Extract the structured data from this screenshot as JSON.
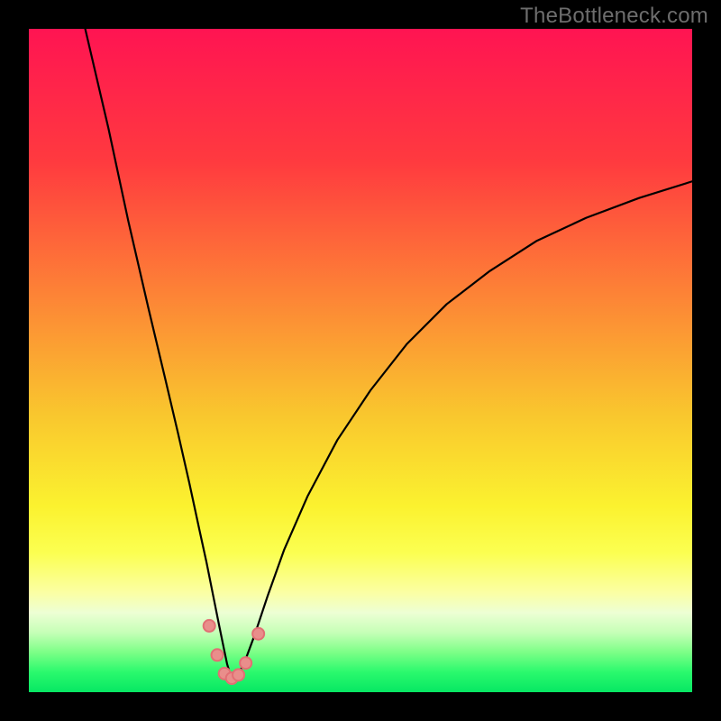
{
  "watermark": "TheBottleneck.com",
  "chart_data": {
    "type": "line",
    "title": "",
    "xlabel": "",
    "ylabel": "",
    "xlim": [
      0,
      100
    ],
    "ylim": [
      0,
      100
    ],
    "grid": false,
    "legend": false,
    "gradient_stops": [
      {
        "offset": 0,
        "color": "#ff1452"
      },
      {
        "offset": 20,
        "color": "#ff3a3f"
      },
      {
        "offset": 40,
        "color": "#fd8336"
      },
      {
        "offset": 58,
        "color": "#f9c62e"
      },
      {
        "offset": 72,
        "color": "#fbf22f"
      },
      {
        "offset": 79,
        "color": "#fbff51"
      },
      {
        "offset": 85,
        "color": "#fbffa4"
      },
      {
        "offset": 88,
        "color": "#edffd4"
      },
      {
        "offset": 91,
        "color": "#c6ffb7"
      },
      {
        "offset": 94,
        "color": "#7cff87"
      },
      {
        "offset": 97,
        "color": "#2af96d"
      },
      {
        "offset": 100,
        "color": "#07e763"
      }
    ],
    "series": [
      {
        "name": "bottleneck-curve",
        "stroke": "#000000",
        "stroke_width": 2.2,
        "x": [
          8.5,
          12,
          15,
          18,
          20.5,
          22.5,
          24.2,
          25.6,
          26.8,
          27.8,
          28.7,
          29.4,
          29.9,
          30.4,
          30.9,
          31.3,
          32.4,
          34.0,
          36.0,
          38.5,
          42.0,
          46.5,
          51.5,
          57.0,
          63.0,
          69.5,
          76.5,
          84.0,
          92.0,
          100.0
        ],
        "y": [
          100,
          85,
          71,
          58,
          47.5,
          39,
          31.5,
          25,
          19.5,
          14.5,
          10,
          6.6,
          4.2,
          2.6,
          2.1,
          2.3,
          4.2,
          8.5,
          14.5,
          21.5,
          29.5,
          38.0,
          45.5,
          52.5,
          58.5,
          63.5,
          68.0,
          71.5,
          74.5,
          77.0
        ]
      }
    ],
    "markers": {
      "stroke": "#e26f74",
      "fill": "#e98e8b",
      "radius": 6.5,
      "points": [
        {
          "x": 27.2,
          "y": 10.0
        },
        {
          "x": 28.4,
          "y": 5.6
        },
        {
          "x": 29.5,
          "y": 2.8
        },
        {
          "x": 30.6,
          "y": 2.1
        },
        {
          "x": 31.6,
          "y": 2.6
        },
        {
          "x": 32.7,
          "y": 4.4
        },
        {
          "x": 34.6,
          "y": 8.8
        }
      ]
    }
  }
}
